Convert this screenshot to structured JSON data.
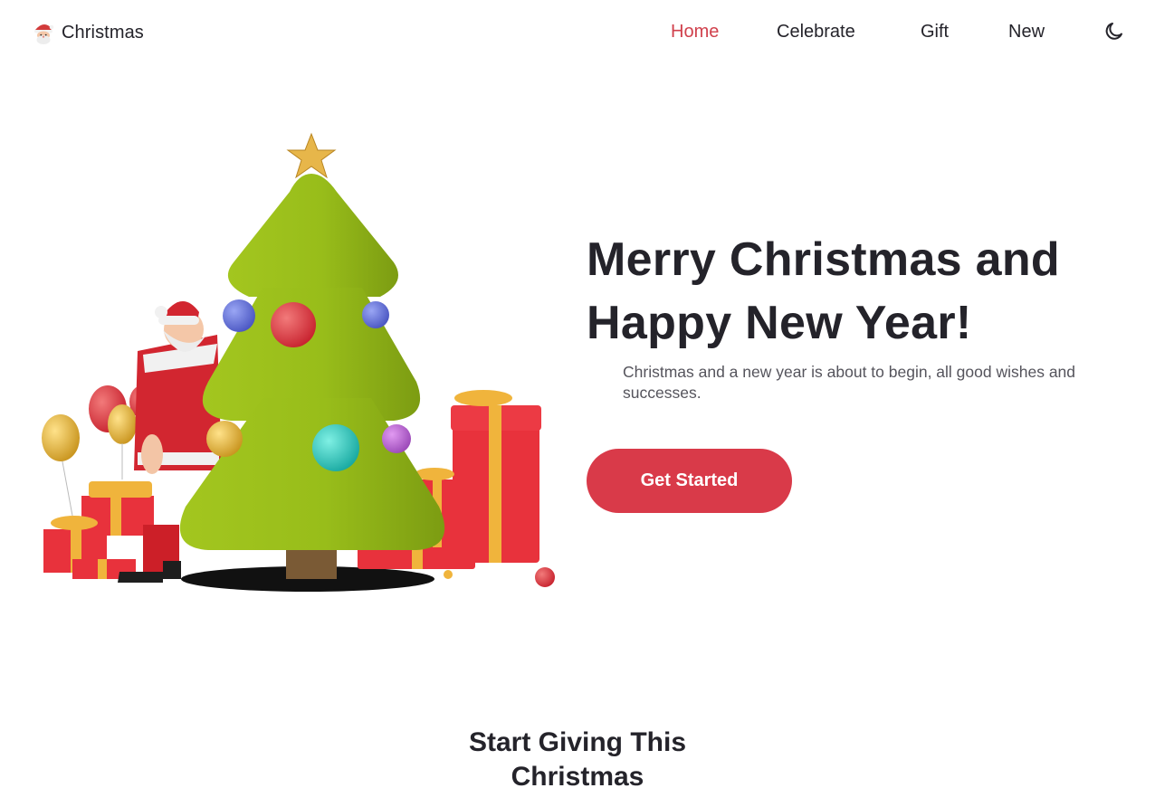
{
  "header": {
    "brand": "Christmas",
    "brand_icon": "santa-face-icon",
    "nav": [
      {
        "label": "Home",
        "active": true
      },
      {
        "label": "Celebrate",
        "active": false
      },
      {
        "label": "Gift",
        "active": false
      },
      {
        "label": "New",
        "active": false
      }
    ],
    "theme_icon": "moon-icon"
  },
  "hero": {
    "title_line1": "Merry Christmas and",
    "title_line2": "Happy New Year!",
    "description": "Christmas and a new year is about to begin, all good wishes and successes.",
    "cta_label": "Get Started",
    "image": "christmas-tree-santa-gifts-illustration"
  },
  "section": {
    "title_line1": "Start Giving This",
    "title_line2": "Christmas"
  },
  "colors": {
    "accent": "#d93a49",
    "active_nav": "#d0404c",
    "text": "#24232a",
    "muted": "#55545c",
    "tree_green": "#8fb51b"
  }
}
